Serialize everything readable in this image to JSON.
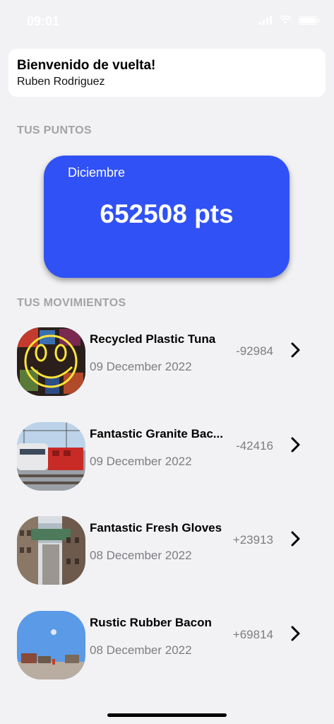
{
  "status_bar": {
    "time": "09:01"
  },
  "welcome": {
    "title": "Bienvenido de vuelta!",
    "name": "Ruben Rodriguez"
  },
  "points_section": {
    "label": "TUS PUNTOS"
  },
  "points_card": {
    "month": "Diciembre",
    "value": "652508 pts",
    "color": "#3051f5"
  },
  "movements_section": {
    "label": "TUS MOVIMIENTOS"
  },
  "movements": [
    {
      "title": "Recycled Plastic Tuna",
      "date": "09 December 2022",
      "amount": "-92984",
      "image": "neon-smiley-image"
    },
    {
      "title": "Fantastic Granite Bac...",
      "date": "09 December 2022",
      "amount": "-42416",
      "image": "train-image"
    },
    {
      "title": "Fantastic Fresh Gloves",
      "date": "08 December 2022",
      "amount": "+23913",
      "image": "city-buildings-image"
    },
    {
      "title": "Rustic Rubber Bacon",
      "date": "08 December 2022",
      "amount": "+69814",
      "image": "sky-beach-image"
    }
  ]
}
